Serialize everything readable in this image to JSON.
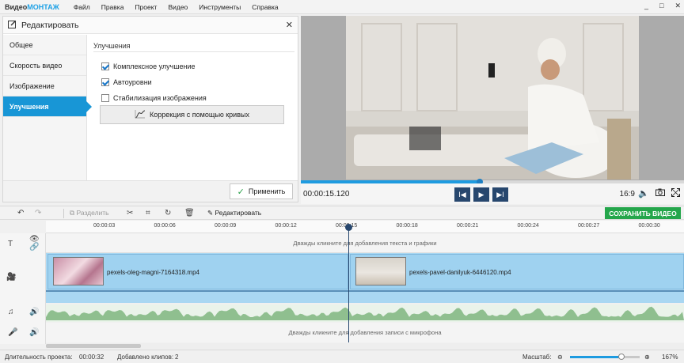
{
  "app": {
    "logo_a": "Видео",
    "logo_b": "МОНТАЖ",
    "menu": [
      "Файл",
      "Правка",
      "Проект",
      "Видео",
      "Инструменты",
      "Справка"
    ],
    "win_controls": [
      "_",
      "□",
      "✕"
    ]
  },
  "editor": {
    "title": "Редактировать",
    "tabs": [
      "Общее",
      "Скорость видео",
      "Изображение",
      "Улучшения"
    ],
    "active_tab": 3,
    "section_title": "Улучшения",
    "options": [
      {
        "label": "Комплексное улучшение",
        "checked": true
      },
      {
        "label": "Автоуровни",
        "checked": true
      },
      {
        "label": "Стабилизация изображения",
        "checked": false
      }
    ],
    "curves_button": "Коррекция с помощью кривых",
    "apply_button": "Применить"
  },
  "player": {
    "timecode": "00:00:15.120",
    "progress": 0.467,
    "ratio": "16:9"
  },
  "toolbar": {
    "split": "Разделить",
    "edit": "Редактировать",
    "save": "СОХРАНИТЬ ВИДЕО"
  },
  "timeline": {
    "ticks": [
      "00:00:03",
      "00:00:06",
      "00:00:09",
      "00:00:12",
      "00:00:15",
      "00:00:18",
      "00:00:21",
      "00:00:24",
      "00:00:27",
      "00:00:30"
    ],
    "text_hint": "Дважды кликните для добавления текста и графики",
    "mic_hint": "Дважды кликните для добавления записи с микрофона",
    "clips": [
      {
        "name": "pexels-oleg-magni-7164318.mp4"
      },
      {
        "name": "pexels-pavel-danilyuk-6446120.mp4"
      }
    ]
  },
  "status": {
    "duration_label": "Длительность проекта:",
    "duration": "00:00:32",
    "clips_label": "Добавлено клипов:",
    "clips": "2",
    "zoom_label": "Масштаб:",
    "zoom": "167%"
  },
  "colors": {
    "accent": "#1896d6",
    "save": "#24a64b",
    "playhead": "#27476e"
  }
}
